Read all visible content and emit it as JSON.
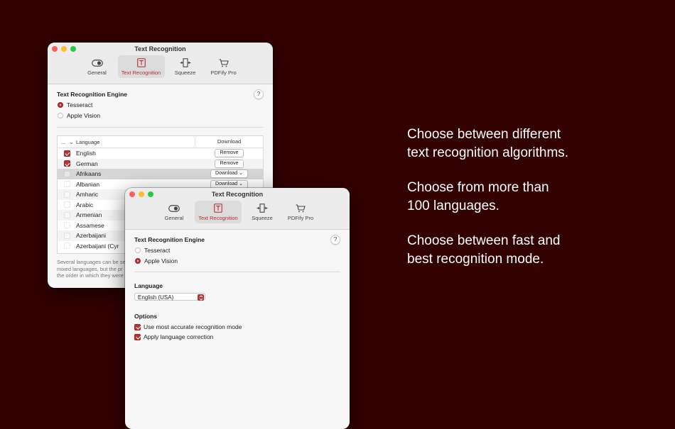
{
  "window_back": {
    "title": "Text Recognition",
    "toolbar": [
      {
        "label": "General",
        "icon": "toggle-icon"
      },
      {
        "label": "Text Recognition",
        "icon": "text-box-icon",
        "active": true
      },
      {
        "label": "Squeeze",
        "icon": "squeeze-icon"
      },
      {
        "label": "PDFify Pro",
        "icon": "cart-icon"
      }
    ],
    "engine_label": "Text Recognition Engine",
    "engine_options": [
      "Tesseract",
      "Apple Vision"
    ],
    "engine_selected": "Tesseract",
    "table": {
      "menu_header": "...",
      "col_language": "Language",
      "col_download": "Download",
      "rows": [
        {
          "language": "English",
          "checked": true,
          "action": "Remove"
        },
        {
          "language": "German",
          "checked": true,
          "action": "Remove"
        },
        {
          "language": "Afrikaans",
          "checked": false,
          "action": "Download"
        },
        {
          "language": "Albanian",
          "checked": false,
          "action": "Download"
        },
        {
          "language": "Amharic",
          "checked": false,
          "action": ""
        },
        {
          "language": "Arabic",
          "checked": false,
          "action": ""
        },
        {
          "language": "Armenian",
          "checked": false,
          "action": ""
        },
        {
          "language": "Assamese",
          "checked": false,
          "action": ""
        },
        {
          "language": "Azerbaijani",
          "checked": false,
          "action": ""
        },
        {
          "language": "Azerbaijani (Cyr",
          "checked": false,
          "action": ""
        }
      ]
    },
    "footnote": "Several languages can be se\nmixed languages, but the pr\nthe order in which they were"
  },
  "window_front": {
    "title": "Text Recognition",
    "toolbar": [
      {
        "label": "General",
        "icon": "toggle-icon"
      },
      {
        "label": "Text Recognition",
        "icon": "text-box-icon",
        "active": true
      },
      {
        "label": "Squeeze",
        "icon": "squeeze-icon"
      },
      {
        "label": "PDFify Pro",
        "icon": "cart-icon"
      }
    ],
    "engine_label": "Text Recognition Engine",
    "engine_options": [
      "Tesseract",
      "Apple Vision"
    ],
    "engine_selected": "Apple Vision",
    "language_label": "Language",
    "language_value": "English (USA)",
    "options_label": "Options",
    "options": [
      {
        "label": "Use most accurate recognition mode",
        "checked": true
      },
      {
        "label": "Apply language correction",
        "checked": true
      }
    ]
  },
  "promo": [
    "Choose between different\ntext recognition algorithms.",
    "Choose from more than\n100  languages.",
    "Choose between fast and\nbest recognition mode."
  ],
  "colors": {
    "background": "#330000",
    "accent": "#b73232"
  }
}
